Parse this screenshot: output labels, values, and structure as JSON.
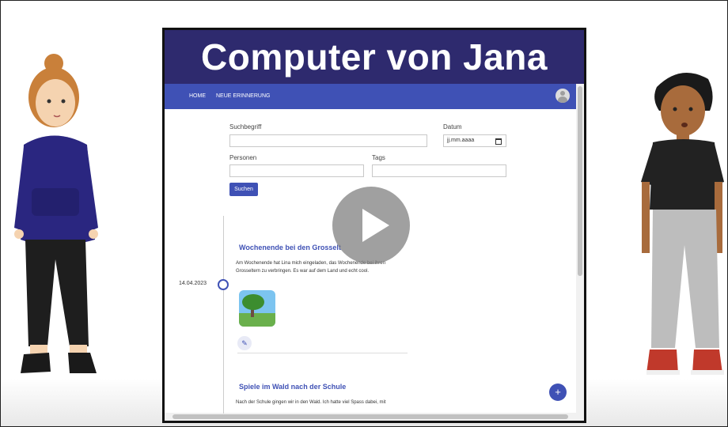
{
  "video": {
    "title": "Computer von Jana"
  },
  "app": {
    "nav": [
      "HOME",
      "NEUE ERINNERUNG"
    ],
    "search_form": {
      "search_label": "Suchbegriff",
      "date_label": "Datum",
      "date_placeholder": "jj.mm.aaaa",
      "persons_label": "Personen",
      "tags_label": "Tags",
      "search_button": "Suchen"
    },
    "entries": [
      {
        "date": "14.04.2023",
        "title": "Wochenende bei den Grosselt",
        "text": "Am Wochenende hat Lina mich eingeladen, das Wochenende bei ihren Grosseltern zu verbringen. Es war auf dem Land und echt cool."
      },
      {
        "title": "Spiele im Wald nach der Schule",
        "text": "Nach der Schule gingen wir in den Wald. Ich hatte viel Spass dabei, mit"
      }
    ]
  },
  "icons": {
    "play": "play-icon",
    "avatar": "account-icon",
    "calendar": "calendar-icon",
    "edit": "pencil-icon",
    "add": "plus-icon"
  },
  "colors": {
    "title_bar": "#2e2a6e",
    "app_bar": "#3f51b5",
    "accent": "#3f51b5"
  }
}
